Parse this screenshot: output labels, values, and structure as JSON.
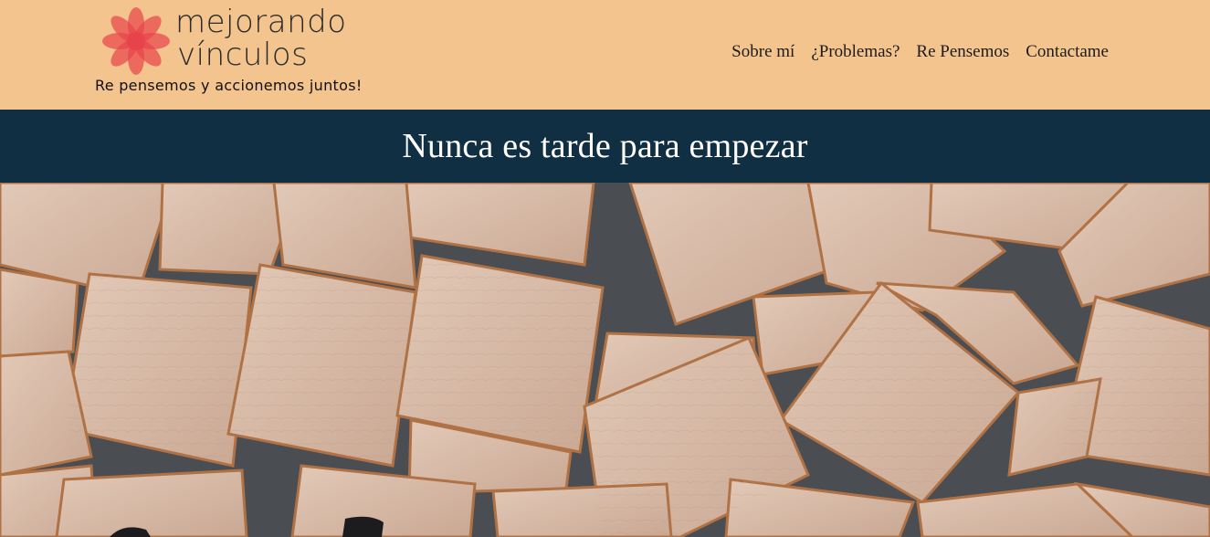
{
  "header": {
    "logo": {
      "line1": "mejorando",
      "line2": "vínculos",
      "tagline": "Re pensemos y accionemos juntos!",
      "flower_color": "#e8434a"
    },
    "nav": [
      {
        "label": "Sobre mí"
      },
      {
        "label": "¿Problemas?"
      },
      {
        "label": "Re Pensemos"
      },
      {
        "label": "Contactame"
      }
    ]
  },
  "banner": {
    "title": "Nunca es tarde para empezar"
  },
  "hero": {
    "image_subject": "wooden-letter-tiles"
  },
  "colors": {
    "header_bg": "#f3c48d",
    "banner_bg": "#112f42",
    "banner_text": "#ffffff"
  }
}
